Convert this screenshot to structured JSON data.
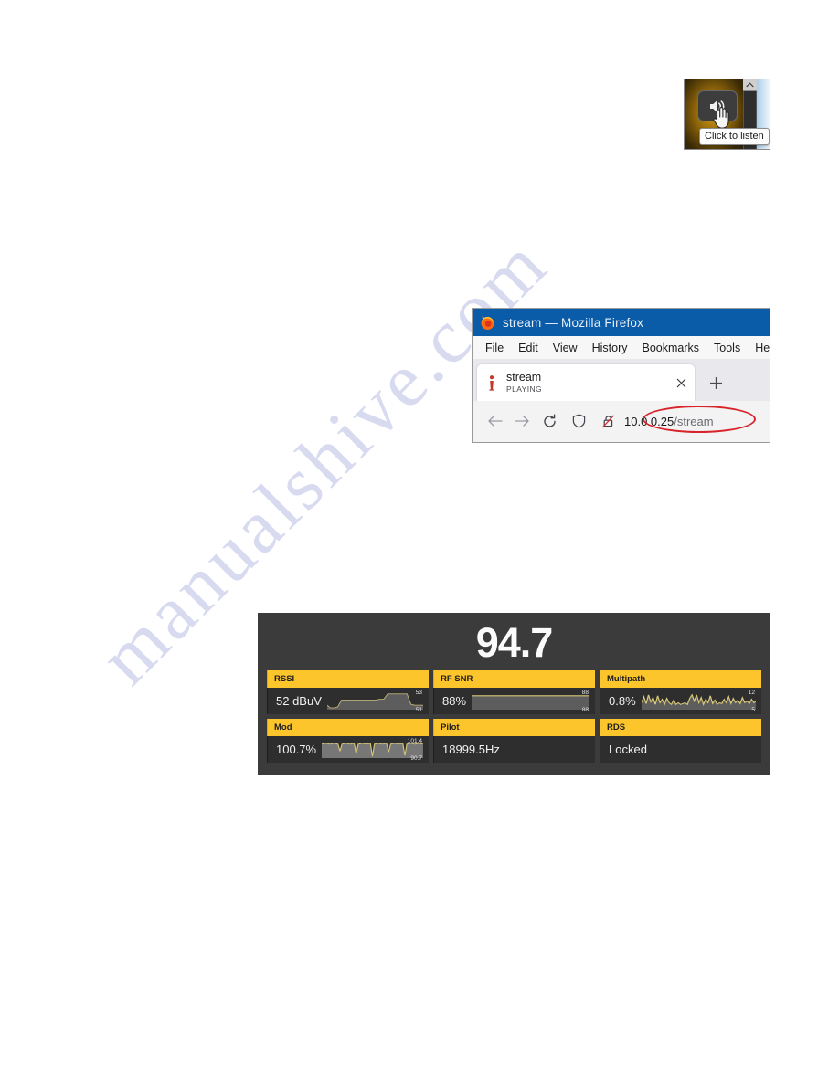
{
  "watermark": {
    "text": "manualshive.com"
  },
  "volume_widget": {
    "button_icon": "speaker-icon",
    "cursor_icon": "hand-pointer-icon",
    "scroll_arrow_icon": "chevron-up-icon",
    "tooltip": "Click to listen"
  },
  "browser": {
    "title": "stream — Mozilla Firefox",
    "logo_icon": "firefox-logo-icon",
    "menu": [
      {
        "pre": "",
        "accel": "F",
        "post": "ile"
      },
      {
        "pre": "",
        "accel": "E",
        "post": "dit"
      },
      {
        "pre": "",
        "accel": "V",
        "post": "iew"
      },
      {
        "pre": "Histo",
        "accel": "r",
        "post": "y"
      },
      {
        "pre": "",
        "accel": "B",
        "post": "ookmarks"
      },
      {
        "pre": "",
        "accel": "T",
        "post": "ools"
      },
      {
        "pre": "",
        "accel": "H",
        "post": "elp"
      }
    ],
    "tab": {
      "favicon_icon": "page-info-icon",
      "title": "stream",
      "status": "PLAYING",
      "close_icon": "close-icon"
    },
    "new_tab_icon": "plus-icon",
    "nav": {
      "back_icon": "arrow-left-icon",
      "forward_icon": "arrow-right-icon",
      "reload_icon": "reload-icon",
      "shield_icon": "shield-icon",
      "lock_icon": "broken-lock-icon"
    },
    "url": {
      "host": "10.0.0.25",
      "path": "/stream"
    },
    "annotation": {
      "shape": "ellipse",
      "color": "#d8232a"
    }
  },
  "radio_panel": {
    "frequency": "94.7",
    "metrics": [
      {
        "label": "RSSI",
        "value": "52 dBuV",
        "max": "53",
        "min": "51",
        "graph": "sparkline"
      },
      {
        "label": "RF SNR",
        "value": "88%",
        "max": "88",
        "min": "88",
        "graph": "sparkline"
      },
      {
        "label": "Multipath",
        "value": "0.8%",
        "max": "12",
        "min": "5",
        "graph": "sparkline"
      },
      {
        "label": "Mod",
        "value": "100.7%",
        "max": "101.4",
        "min": "90.7",
        "graph": "sparkline"
      },
      {
        "label": "Pilot",
        "value": "18999.5Hz",
        "max": "",
        "min": "",
        "graph": "none"
      },
      {
        "label": "RDS",
        "value": "Locked",
        "max": "",
        "min": "",
        "graph": "none"
      }
    ],
    "colors": {
      "header": "#fcc52b",
      "body": "#2e2e2e",
      "panel": "#3b3b3b",
      "trace": "#d9c87a"
    }
  },
  "chart_data": [
    {
      "type": "line",
      "title": "RSSI",
      "ylabel": "dBuV",
      "ylim": [
        51,
        53
      ],
      "values": [
        51.2,
        51.0,
        51.0,
        51.1,
        51.6,
        51.9,
        51.9,
        51.9,
        51.9,
        51.9,
        51.9,
        51.9,
        51.9,
        51.9,
        52.0,
        52.0,
        52.8,
        52.9,
        52.9,
        52.9,
        52.9,
        52.9,
        51.3,
        51.2
      ],
      "current": 52
    },
    {
      "type": "line",
      "title": "RF SNR",
      "ylabel": "%",
      "ylim": [
        88,
        88
      ],
      "values": [
        88,
        88,
        88,
        88,
        88,
        88,
        88,
        88,
        88,
        88,
        88,
        88,
        88,
        88,
        88,
        88,
        88,
        88,
        88,
        88
      ],
      "current": 88
    },
    {
      "type": "line",
      "title": "Multipath",
      "ylabel": "%",
      "ylim": [
        5,
        12
      ],
      "values": [
        7,
        10,
        6,
        11,
        7,
        9,
        6,
        10,
        7,
        8,
        6,
        9,
        7,
        6,
        8,
        6,
        7,
        6,
        6,
        7,
        6,
        9,
        11,
        8,
        11,
        7,
        10,
        6,
        9,
        7,
        11,
        6,
        8,
        6,
        7,
        6
      ],
      "current": 0.8
    },
    {
      "type": "line",
      "title": "Mod",
      "ylabel": "%",
      "ylim": [
        90.7,
        101.4
      ],
      "values": [
        101.0,
        101.2,
        101.1,
        101.3,
        97.0,
        101.2,
        101.1,
        101.3,
        101.2,
        95.0,
        101.1,
        101.2,
        101.3,
        91.0,
        101.2,
        101.1,
        101.3,
        101.2,
        101.1,
        92.5,
        101.2,
        101.3,
        101.1,
        90.7,
        101.2,
        101.1,
        101.3,
        101.2,
        101.0
      ],
      "current": 100.7
    }
  ]
}
